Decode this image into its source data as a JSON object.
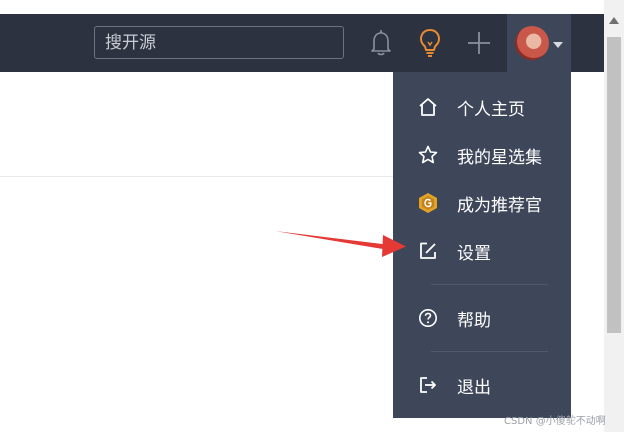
{
  "navbar": {
    "search_placeholder": "搜开源",
    "icons": [
      "bell-icon",
      "lightbulb-icon",
      "plus-icon"
    ],
    "accent_color": "#e88b2f"
  },
  "user_menu": {
    "items": [
      {
        "label": "个人主页",
        "icon": "home-icon"
      },
      {
        "label": "我的星选集",
        "icon": "star-icon"
      },
      {
        "label": "成为推荐官",
        "icon": "badge-icon"
      },
      {
        "label": "设置",
        "icon": "edit-icon"
      },
      {
        "label": "帮助",
        "icon": "help-icon"
      },
      {
        "label": "退出",
        "icon": "logout-icon"
      }
    ]
  },
  "watermark": "CSDN @小傻鸵不动啊"
}
